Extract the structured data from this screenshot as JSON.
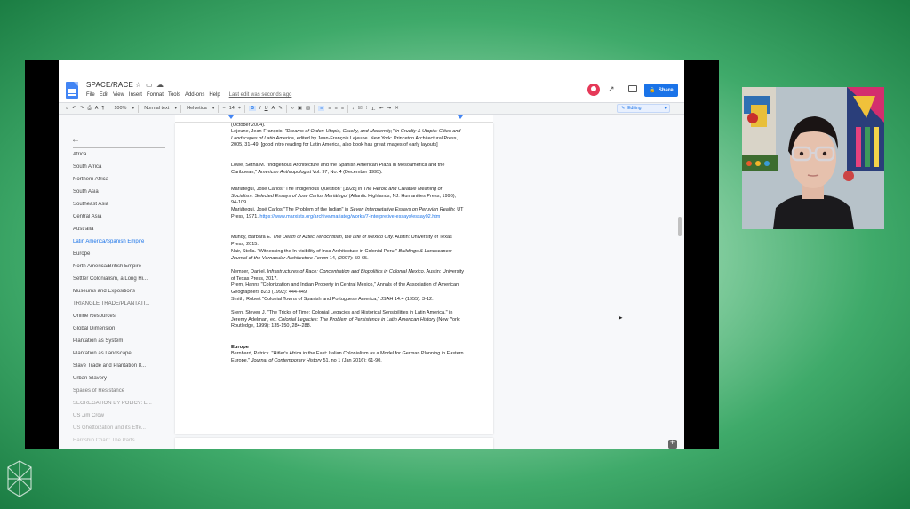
{
  "document": {
    "title": "SPACE/RACE",
    "menu": [
      "File",
      "Edit",
      "View",
      "Insert",
      "Format",
      "Tools",
      "Add-ons",
      "Help"
    ],
    "last_edit": "Last edit was seconds ago",
    "share_label": "Share"
  },
  "toolbar": {
    "zoom": "100%",
    "style": "Normal text",
    "font": "Helvetica",
    "size": "14",
    "bold": "B",
    "italic": "I",
    "underline": "U",
    "text_color": "A",
    "mode": "Editing"
  },
  "outline": {
    "items": [
      {
        "label": "Africa"
      },
      {
        "label": "South Africa"
      },
      {
        "label": "Northern Africa"
      },
      {
        "label": "South Asia"
      },
      {
        "label": "Southeast Asia"
      },
      {
        "label": "Central Asia"
      },
      {
        "label": "Australia"
      },
      {
        "label": "Latin America/Spanish Empire",
        "selected": true
      },
      {
        "label": "Europe"
      },
      {
        "label": "North America/British Empire"
      },
      {
        "label": "Settler Colonialism, a Long Hi..."
      },
      {
        "label": "Museums and Expositions"
      },
      {
        "label": "TRIANGLE TRADE/PLANTATI..."
      },
      {
        "label": "Online Resources"
      },
      {
        "label": "Global Dimension"
      },
      {
        "label": "Plantation as System"
      },
      {
        "label": "Plantation as Landscape"
      },
      {
        "label": "Slave Trade and Plantation 8..."
      },
      {
        "label": "Urban Slavery"
      },
      {
        "label": "Spaces of Resistance"
      },
      {
        "label": "SEGREGATION BY POLICY: E..."
      },
      {
        "label": "US Jim Crow"
      },
      {
        "label": "US Ghettoization and its Effe..."
      },
      {
        "label": "Hardship Chart: The Parts..."
      }
    ]
  },
  "page": {
    "top_line": "(October 2004).",
    "refs": [
      {
        "plain": "Lejeune, Jean-François. ",
        "italic": "\"Dreams of Order: Utopia, Cruelty, and Modernity,\" in Cruelty & Utopia: Cities and Landscapes of Latin America,",
        "rest": " edited by Jean-François Lejeune. New York: Princeton Architectural Press, 2005, 31–49. [good intro reading for Latin America, also book has great images of early layouts]"
      },
      {
        "plain": "Lowe, Setha M. \"Indigenous Architecture and the Spanish American Plaza in Mesoamerica and the Caribbean,\" ",
        "italic": "American Anthropologist",
        "rest": " Vol. 97, No. 4 (December 1995)."
      },
      {
        "plain": "Mariátegui, José Carlos \"The Indigenous Question\" [1928] in ",
        "italic": "The Heroic and Creative Meaning of Socialism: Selected Essays of Jose Carlos Mariátegui",
        "rest": " (Atlantic Highlands, NJ: Humanities Press, 1996), 94-109."
      },
      {
        "plain": "Mariátegui, José Carlos \"The Problem of the Indian\" in ",
        "italic": "Seven Interpretative Essays on Peruvian Reality.",
        "rest": " UT Press, 1971. ",
        "link": "https://www.marxists.org/archive/mariateg/works/7-interpretive-essays/essay02.htm"
      },
      {
        "plain": "Mundy, Barbara E. ",
        "italic": "The Death of Aztec Tenochtitlan, the Life of Mexico City.",
        "rest": " Austin: University of Texas Press, 2015."
      },
      {
        "plain": "Nair, Stella. \"Witnessing the In-visibility of Inca Architecture in Colonial Peru,\" ",
        "italic": "Buildings & Landscapes: Journal of the Vernacular Architecture Forum",
        "rest": " 14, (2007): 50-65."
      },
      {
        "plain": "Nemser, Daniel. ",
        "italic": "Infrastructures of Race: Concentration and Biopolitics in Colonial Mexico.",
        "rest": " Austin: University of Texas Press, 2017."
      },
      {
        "plain": "Prem, Hanns \"Colonization and Indian Property in Central Mexico,\" Annals of the Association of American Geographers 82:3 (1992): 444-449.",
        "italic": "",
        "rest": ""
      },
      {
        "plain": "Smith, Robert \"Colonial Towns of Spanish and Portuguese America,\" JSAH 14:4 (1955): 3-12.",
        "italic": "",
        "rest": ""
      },
      {
        "plain": "Stern, Steven J. \"The Tricks of Time: Colonial Legacies and Historical Sensibilities in Latin America,\" in Jeremy Adelman, ed. ",
        "italic": "Colonial Legacies: The Problem of Persistence in Latin American History",
        "rest": " (New York: Routledge, 1999): 135-150, 284-288."
      }
    ],
    "europe_heading": "Europe",
    "europe_ref": {
      "plain": "Bernhard, Patrick. \"Hitler's Africa in the East: Italian Colonialism as a Model for German Planning in Eastern Europe,\" ",
      "italic": "Journal of Contemporary History",
      "rest": " 51, no 1 (Jan 2016): 61-90."
    }
  },
  "colors": {
    "accent": "#1a73e8",
    "background_green": "#1f8a4a",
    "avatar": "#e53958"
  }
}
